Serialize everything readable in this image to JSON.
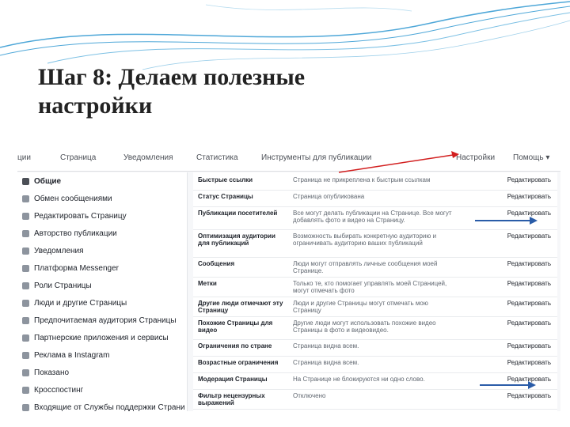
{
  "slide": {
    "title_line1": "Шаг 8:  Делаем  полезные",
    "title_line2": "настройки"
  },
  "colors": {
    "wave": "#4ea7d8",
    "red_arrow": "#d21f1f",
    "blue_arrow": "#2a5ca8"
  },
  "nav": {
    "items": [
      "ции",
      "Страница",
      "Уведомления",
      "Статистика",
      "Инструменты для публикации",
      "Настройки",
      "Помощь ▾"
    ]
  },
  "sidebar": {
    "items": [
      {
        "label": "Общие",
        "icon": "gear-icon"
      },
      {
        "label": "Обмен сообщениями",
        "icon": "message-icon"
      },
      {
        "label": "Редактировать Страницу",
        "icon": "grid-icon"
      },
      {
        "label": "Авторство публикации",
        "icon": "flag-icon"
      },
      {
        "label": "Уведомления",
        "icon": "globe-icon"
      },
      {
        "label": "Платформа Messenger",
        "icon": "messenger-icon"
      },
      {
        "label": "Роли Страницы",
        "icon": "person-icon"
      },
      {
        "label": "Люди и другие Страницы",
        "icon": "people-icon"
      },
      {
        "label": "Предпочитаемая аудитория Страницы",
        "icon": "audience-icon"
      },
      {
        "label": "Партнерские приложения и сервисы",
        "icon": "apps-icon"
      },
      {
        "label": "Реклама в Instagram",
        "icon": "instagram-icon"
      },
      {
        "label": "Показано",
        "icon": "star-icon"
      },
      {
        "label": "Кросспостинг",
        "icon": "video-icon"
      },
      {
        "label": "Входящие от Службы поддержки Страни",
        "icon": "inbox-icon"
      }
    ]
  },
  "settings": {
    "edit_label": "Редактировать",
    "rows": [
      {
        "label": "Быстрые ссылки",
        "desc": "Страница не прикреплена к быстрым ссылкам"
      },
      {
        "label": "Статус Страницы",
        "desc": "Страница опубликована"
      },
      {
        "label": "Публикации посетителей",
        "desc": "Все могут делать публикации на Странице. Все могут добавлять фото и видео на Страницу."
      },
      {
        "label": "Оптимизация аудитории для публикаций",
        "desc": "Возможность выбирать конкретную аудиторию и ограничивать аудиторию ваших публикаций"
      },
      {
        "label": "Сообщения",
        "desc": "Люди могут отправлять личные сообщения моей Странице."
      },
      {
        "label": "Метки",
        "desc": "Только те, кто помогает управлять моей Страницей, могут отмечать фото"
      },
      {
        "label": "Другие люди отмечают эту Страницу",
        "desc": "Люди и другие Страницы могут отмечать мою Страницу"
      },
      {
        "label": "Похожие Страницы для видео",
        "desc": "Другие люди могут использовать похожие видео Страницы в фото и видеовидео."
      },
      {
        "label": "Ограничения по стране",
        "desc": "Страница видна всем."
      },
      {
        "label": "Возрастные ограничения",
        "desc": "Страница видна всем."
      },
      {
        "label": "Модерация Страницы",
        "desc": "На Странице не блокируются ни одно слово."
      },
      {
        "label": "Фильтр нецензурных выражений",
        "desc": "Отключено"
      }
    ]
  }
}
